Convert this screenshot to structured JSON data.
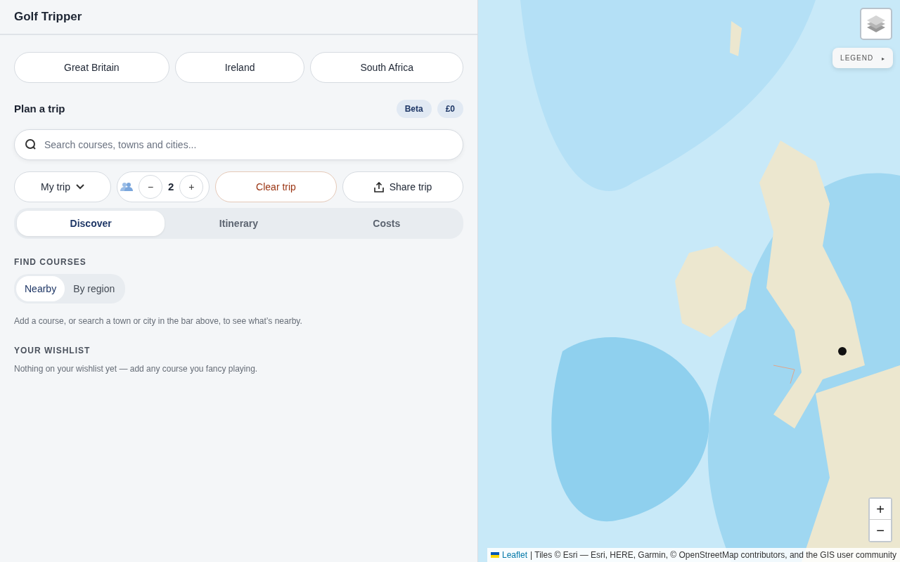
{
  "app": {
    "title": "Golf Tripper"
  },
  "countries": [
    {
      "label": "Great Britain",
      "selected": false
    },
    {
      "label": "Ireland",
      "selected": false
    },
    {
      "label": "South Africa",
      "selected": false
    }
  ],
  "plan": {
    "title": "Plan a trip",
    "badges": [
      "Beta",
      "£0"
    ],
    "search": {
      "placeholder": "Search courses, towns and cities..."
    }
  },
  "toolbar": {
    "my_trip": "My trip",
    "players": {
      "minus": "−",
      "count": "2",
      "plus": "+"
    },
    "clear": "Clear trip",
    "share": "Share trip"
  },
  "tabs": [
    {
      "label": "Discover",
      "selected": true
    },
    {
      "label": "Itinerary",
      "selected": false
    },
    {
      "label": "Costs",
      "selected": false
    }
  ],
  "find_courses": {
    "heading": "FIND COURSES",
    "modes": [
      {
        "label": "Nearby",
        "selected": true
      },
      {
        "label": "By region",
        "selected": false
      }
    ],
    "hint": "Add a course, or search a town or city in the bar above, to see what’s nearby."
  },
  "wishlist": {
    "heading": "YOUR WISHLIST",
    "text": "Nothing on your wishlist yet — add any course you fancy playing."
  },
  "map": {
    "kind": "picture",
    "legend": {
      "label": "LEGEND",
      "arrow": "▸"
    },
    "zoom": {
      "in": "+",
      "out": "−"
    },
    "attribution": {
      "link": "Leaflet",
      "text": "| Tiles © Esri — Esri, HERE, Garmin, © OpenStreetMap contributors, and the GIS user community"
    }
  }
}
